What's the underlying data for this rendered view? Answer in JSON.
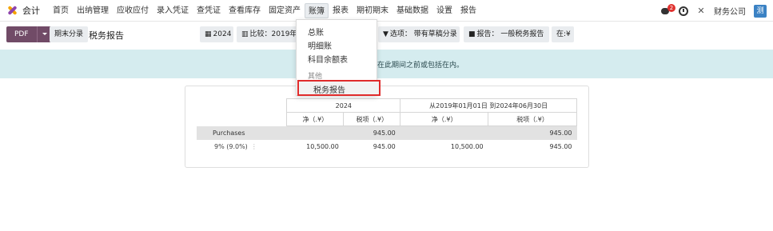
{
  "nav": {
    "app_name": "会计",
    "items": [
      "首页",
      "出纳管理",
      "应收应付",
      "录入凭证",
      "查凭证",
      "查看库存",
      "固定资产",
      "账簿",
      "报表",
      "期初期末",
      "基础数据",
      "设置",
      "报告"
    ],
    "active_index": 7,
    "chat_badge": "2",
    "company": "财务公司",
    "user_initial": "测"
  },
  "control": {
    "pdf_label": "PDF",
    "period_close_label": "期末分录",
    "title": "税务报告",
    "filter_date": "2024",
    "filter_compare": "比较：2019年1",
    "filter_options": "选项：  带有草稿分录",
    "filter_report": "报告：  一般税务报告",
    "filter_currency": "在:¥"
  },
  "dropdown": {
    "items": [
      "总账",
      "明细账",
      "科目余额表"
    ],
    "section_header": "其他",
    "highlighted_item": "税务报告"
  },
  "alert": {
    "text": "在此期间之前或包括在内。"
  },
  "report": {
    "col_groups": [
      "2024",
      "从2019年01月01日 到2024年06月30日"
    ],
    "sub_headers": [
      "净（.¥）",
      "税项（.¥）",
      "净（.¥）",
      "税项（.¥）"
    ],
    "rows": [
      {
        "label": "Purchases",
        "type": "section",
        "values": [
          "",
          "945.00",
          "",
          "945.00"
        ]
      },
      {
        "label": "9% (9.0%)",
        "type": "line",
        "values": [
          "10,500.00",
          "945.00",
          "10,500.00",
          "945.00"
        ]
      }
    ]
  },
  "colors": {
    "brand": "#714b67",
    "alert_bg": "#d5ecef",
    "highlight_border": "#e02b2b"
  }
}
